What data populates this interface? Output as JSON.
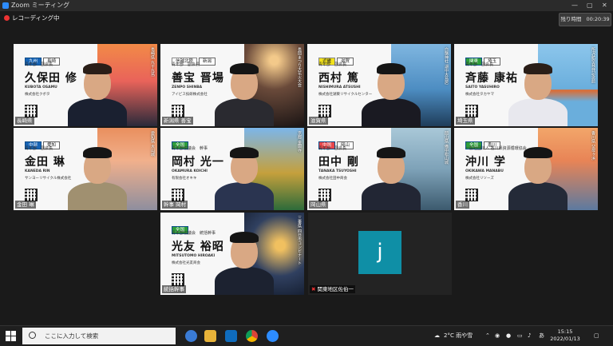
{
  "window": {
    "title": "Zoom ミーティング",
    "minimize": "—",
    "maximize": "▢",
    "close": "✕"
  },
  "recording": {
    "label": "レコーディング中"
  },
  "timer": {
    "label": "残り時間",
    "value": "00:20:39"
  },
  "tiles": [
    {
      "region": "九州",
      "pref": "長崎",
      "region_color": "#1764b5",
      "role": "青年部　副会長",
      "name": "久保田 修",
      "roman": "KUBOTA OSAMU",
      "company": "株式会社クボタ",
      "bg_text": "長崎県 九十九島",
      "label": "長崎県"
    },
    {
      "region": "信越北陸",
      "pref": "新潟",
      "region_color": "#ffffff",
      "role": "青年部　副会長",
      "name": "善宝 晋場",
      "roman": "ZENPO SHINBA",
      "company": "アイビス技研株式会社",
      "bg_text": "長岡まつり大花火大会",
      "label": "新潟県 善宝"
    },
    {
      "region": "近畿",
      "pref": "滋賀",
      "region_color": "#f2e21a",
      "role": "青年部　副会長",
      "name": "西村 篤",
      "roman": "NISHIMURA ATSUSHI",
      "company": "株式会社湖東リサイクルセンター",
      "bg_text": "白鬚神社 湖中大鳥居",
      "label": "滋賀県"
    },
    {
      "region": "関東",
      "pref": "埼玉",
      "region_color": "#2e9e3a",
      "role": "青年部　副会長",
      "name": "斉藤 康祐",
      "roman": "SAITO YASUHIRO",
      "company": "株式会社タカヤマ",
      "bg_text": "所沢航空発祥記念館",
      "label": "埼玉県"
    },
    {
      "region": "中部",
      "pref": "愛知",
      "region_color": "#1764b5",
      "role": "青年部　副会長",
      "name": "金田 琳",
      "roman": "KANEDA RIN",
      "company": "サンヨーリサイクル株式会社",
      "bg_text": "愛知県 大山城",
      "label": "金田 琳"
    },
    {
      "region": "全国",
      "pref": "",
      "region_color": "#2e9e3a",
      "role": "青年部協議会　幹事",
      "name": "岡村 光一",
      "roman": "OKAMURA KOICHI",
      "company": "有限会社オキキ",
      "bg_text": "京都 金閣寺",
      "label": "幹事 岡村"
    },
    {
      "region": "中国",
      "pref": "岡山",
      "region_color": "#e8464a",
      "role": "青年部　副会長",
      "name": "田中 剛",
      "roman": "TANAKA TSUYOSHI",
      "company": "株式会社田中商会",
      "bg_text": "岡山県 備中松山城",
      "label": "岡山県"
    },
    {
      "region": "全国",
      "pref": "香川",
      "region_color": "#2e9e3a",
      "role": "一般社団法人 香川県資源循環協会",
      "name": "沖川 学",
      "roman": "OKIKAWA MANABU",
      "company": "株式会社リソーズ",
      "bg_text": "香川県 父母ヶ浜",
      "label": "香川"
    },
    {
      "region": "全国",
      "pref": "",
      "region_color": "#2e9e3a",
      "role": "青年部協議会　統括幹事",
      "name": "光友 裕昭",
      "roman": "MITSUTOMO HIROAKI",
      "company": "株式会社光友商会",
      "bg_text": "三重県 四日市コンビナート",
      "label": "統括幹事"
    }
  ],
  "jtile": {
    "avatar_letter": "j",
    "label": "関東地区佐伯一"
  },
  "taskbar": {
    "search_placeholder": "ここに入力して検索",
    "weather": "2°C 雨や雪",
    "ime": "あ",
    "time": "15:15",
    "date": "2022/01/13"
  }
}
